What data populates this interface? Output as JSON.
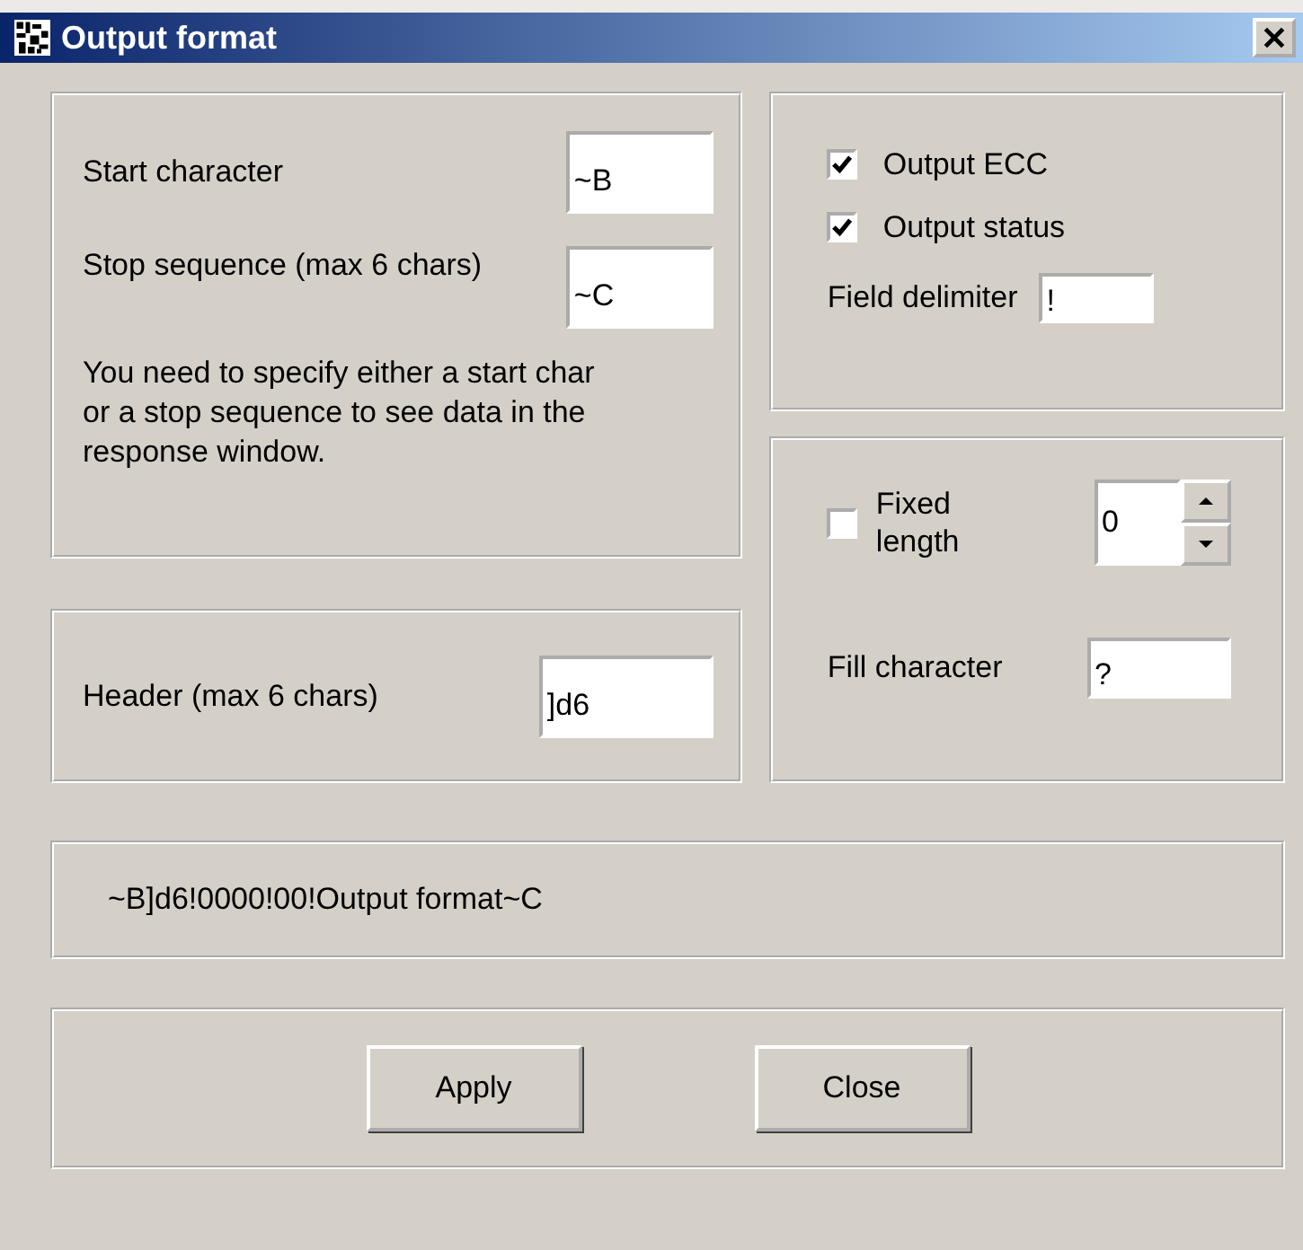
{
  "window": {
    "title": "Output format"
  },
  "delimiters": {
    "start_label": "Start character",
    "start_value": "~B",
    "stop_label": "Stop sequence (max 6 chars)",
    "stop_value": "~C",
    "note": "You need to specify either a start char or a stop sequence to see data in the response window."
  },
  "header": {
    "label": "Header (max 6 chars)",
    "value": "]d6"
  },
  "output_options": {
    "checkboxes": [
      {
        "label": "Output ECC",
        "checked": true
      },
      {
        "label": "Output status",
        "checked": true
      }
    ],
    "field_delimiter_label": "Field delimiter",
    "field_delimiter_value": "!"
  },
  "fixed_length": {
    "label": "Fixed length",
    "checked": false,
    "value": "0",
    "fill_label": "Fill character",
    "fill_value": "?"
  },
  "preview": "~B]d6!0000!00!Output format~C",
  "buttons": [
    "Apply",
    "Close"
  ]
}
